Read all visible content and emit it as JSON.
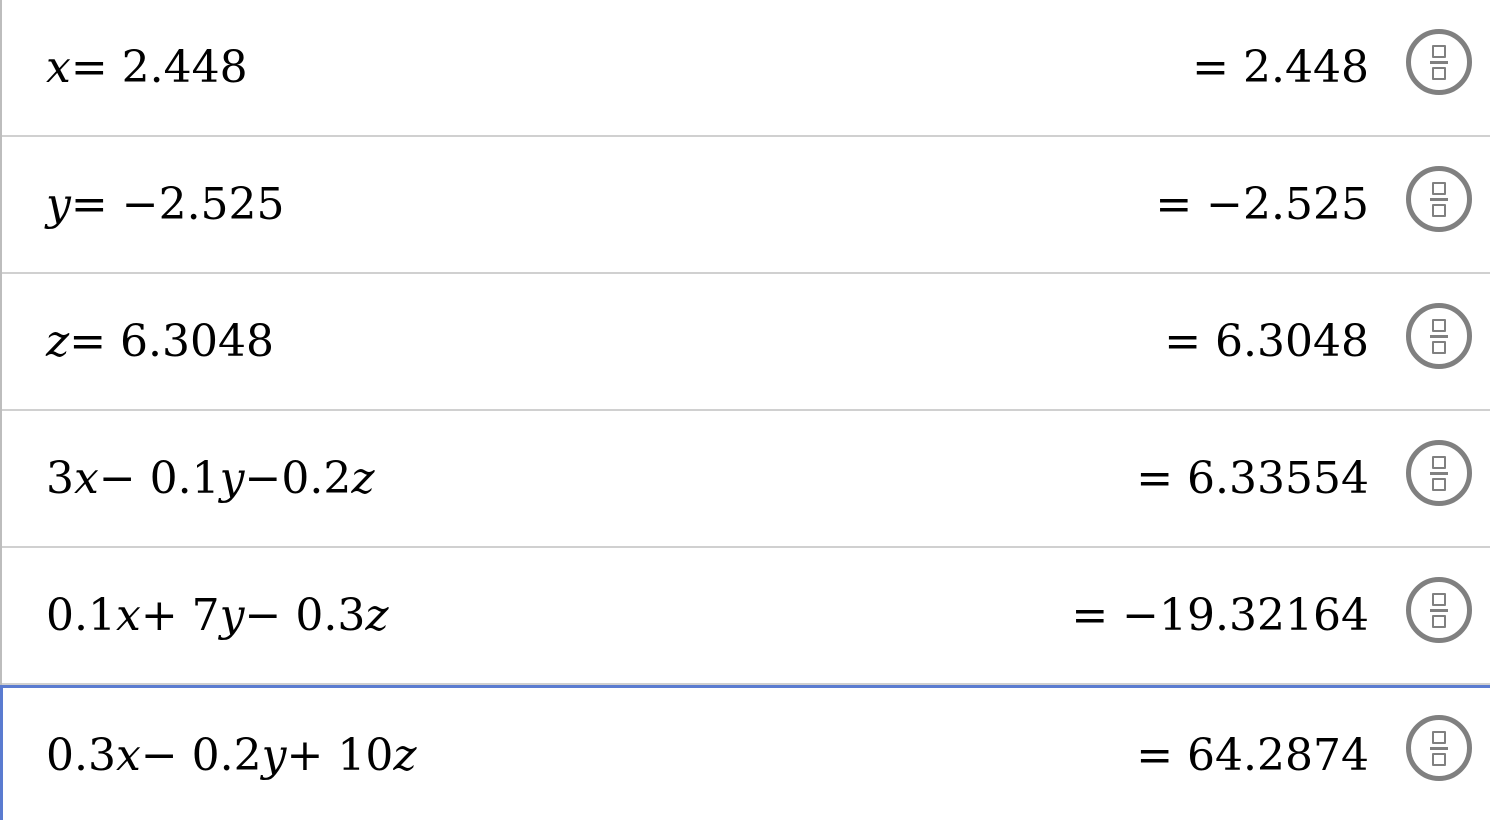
{
  "rows": [
    {
      "expression_parts": [
        {
          "t": "x",
          "v": true
        },
        {
          "t": " = 2.448",
          "v": false
        }
      ],
      "result": "= 2.448"
    },
    {
      "expression_parts": [
        {
          "t": "y",
          "v": true
        },
        {
          "t": " = −2.525",
          "v": false
        }
      ],
      "result": "= −2.525"
    },
    {
      "expression_parts": [
        {
          "t": "z",
          "v": true
        },
        {
          "t": " = 6.3048",
          "v": false
        }
      ],
      "result": "= 6.3048"
    },
    {
      "expression_parts": [
        {
          "t": "3",
          "v": false
        },
        {
          "t": "x",
          "v": true
        },
        {
          "t": " − 0.1",
          "v": false
        },
        {
          "t": "y",
          "v": true
        },
        {
          "t": "−0.2",
          "v": false
        },
        {
          "t": "z",
          "v": true
        }
      ],
      "result": "= 6.33554"
    },
    {
      "expression_parts": [
        {
          "t": "0.1",
          "v": false
        },
        {
          "t": "x",
          "v": true
        },
        {
          "t": " + 7",
          "v": false
        },
        {
          "t": "y",
          "v": true
        },
        {
          "t": " − 0.3",
          "v": false
        },
        {
          "t": "z",
          "v": true
        }
      ],
      "result": "= −19.32164"
    },
    {
      "expression_parts": [
        {
          "t": "0.3",
          "v": false
        },
        {
          "t": "x",
          "v": true
        },
        {
          "t": " − 0.2",
          "v": false
        },
        {
          "t": "y",
          "v": true
        },
        {
          "t": " + 10",
          "v": false
        },
        {
          "t": "z",
          "v": true
        }
      ],
      "result": "= 64.2874"
    }
  ],
  "active_row": 5,
  "toggle_icon": "fraction-toggle-icon",
  "colors": {
    "active_border": "#5a7bd0",
    "divider": "#d0d0d0",
    "icon": "#808080"
  }
}
